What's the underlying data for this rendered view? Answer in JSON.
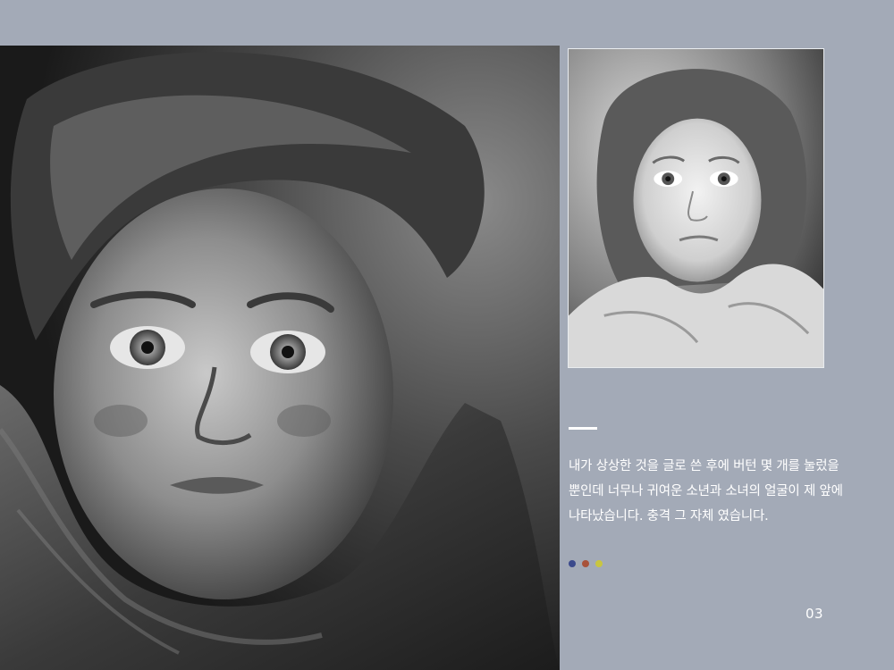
{
  "caption": {
    "lines": [
      "내가 상상한 것을 글로 쓴 후에 버턴 몇 개를 눌렀을",
      "뿐인데 너무나 귀여운 소년과 소녀의 얼굴이 제 앞에",
      "나타났습니다. 충격 그 자체 였습니다."
    ]
  },
  "page_number": "03",
  "colors": {
    "background": "#a3aab7",
    "accent_bar": "#ffffff",
    "dot_blue": "#3b4a8c",
    "dot_red": "#a8523a",
    "dot_yellow": "#c9c640"
  },
  "images": {
    "hero": "charcoal portrait of a boy wrapped in a scarf",
    "thumb": "pencil sketch portrait of a girl"
  }
}
